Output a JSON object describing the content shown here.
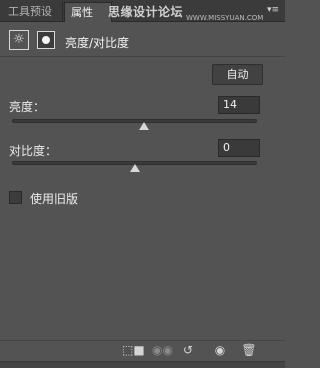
{
  "tabs": [
    "工具预设",
    "属性"
  ],
  "watermark": {
    "text": "思缘设计论坛",
    "url": "WWW.MISSYUAN.COM"
  },
  "icons": {
    "menu": "panel-menu-icon",
    "adjustment": "brightness-contrast-icon",
    "mask": "layer-mask-icon",
    "bottom": [
      "clip-to-layer-icon",
      "view-previous-state-icon",
      "reset-icon",
      "visibility-eye-icon",
      "trash-icon"
    ]
  },
  "panel_title": "亮度/对比度",
  "auto_button": "自动",
  "brightness": {
    "label": "亮度：",
    "value": "14",
    "slider_fraction": 0.54
  },
  "contrast": {
    "label": "对比度：",
    "value": "0",
    "slider_fraction": 0.5
  },
  "legacy_checkbox": {
    "label": "使用旧版",
    "checked": false
  }
}
